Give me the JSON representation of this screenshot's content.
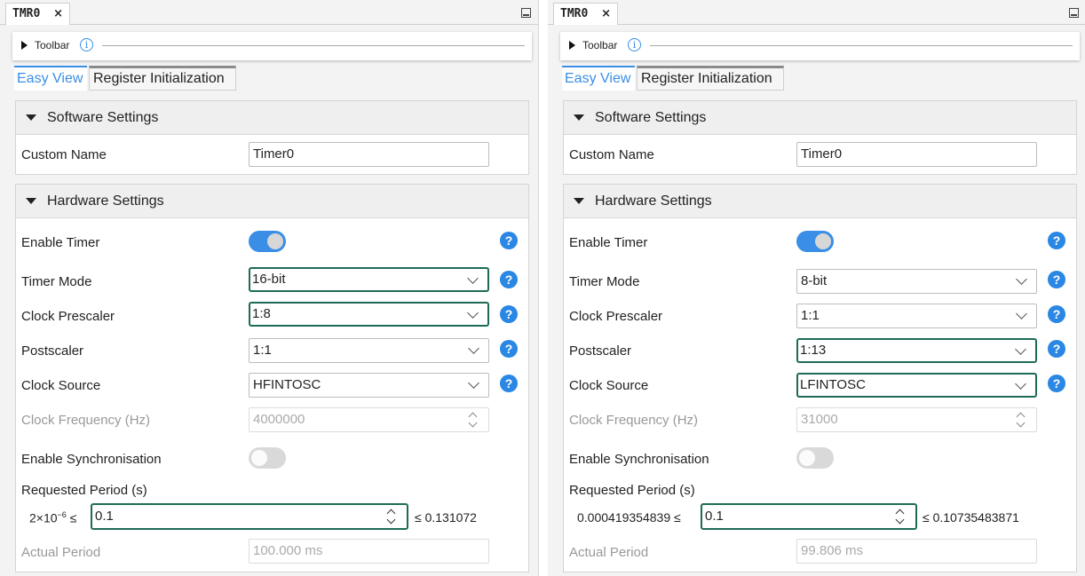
{
  "panels": [
    {
      "tab_title": "TMR0",
      "tab_close": "×",
      "toolbar_label": "Toolbar",
      "toolbar_info": "i",
      "view_tabs": {
        "easy": "Easy View",
        "register": "Register Initialization"
      },
      "software": {
        "title": "Software Settings",
        "custom_name_label": "Custom Name",
        "custom_name_value": "Timer0"
      },
      "hardware": {
        "title": "Hardware Settings",
        "enable_timer_label": "Enable Timer",
        "enable_timer_on": true,
        "timer_mode_label": "Timer Mode",
        "timer_mode_value": "16-bit",
        "prescaler_label": "Clock Prescaler",
        "prescaler_value": "1:8",
        "postscaler_label": "Postscaler",
        "postscaler_value": "1:1",
        "clock_source_label": "Clock Source",
        "clock_source_value": "HFINTOSC",
        "clock_freq_label": "Clock Frequency (Hz)",
        "clock_freq_value": "4000000",
        "sync_label": "Enable Synchronisation",
        "sync_on": false,
        "requested_period_label": "Requested Period (s)",
        "period_min_base": "2×10",
        "period_min_exp": "−6",
        "period_min_suffix": " ≤",
        "period_value": "0.1",
        "period_max": "≤ 0.131072",
        "actual_period_label": "Actual Period",
        "actual_period_value": "100.000 ms"
      }
    },
    {
      "tab_title": "TMR0",
      "tab_close": "×",
      "toolbar_label": "Toolbar",
      "toolbar_info": "i",
      "view_tabs": {
        "easy": "Easy View",
        "register": "Register Initialization"
      },
      "software": {
        "title": "Software Settings",
        "custom_name_label": "Custom Name",
        "custom_name_value": "Timer0"
      },
      "hardware": {
        "title": "Hardware Settings",
        "enable_timer_label": "Enable Timer",
        "enable_timer_on": true,
        "timer_mode_label": "Timer Mode",
        "timer_mode_value": "8-bit",
        "prescaler_label": "Clock Prescaler",
        "prescaler_value": "1:1",
        "postscaler_label": "Postscaler",
        "postscaler_value": "1:13",
        "clock_source_label": "Clock Source",
        "clock_source_value": "LFINTOSC",
        "clock_freq_label": "Clock Frequency (Hz)",
        "clock_freq_value": "31000",
        "sync_label": "Enable Synchronisation",
        "sync_on": false,
        "requested_period_label": "Requested Period (s)",
        "period_min": "0.000419354839 ≤",
        "period_value": "0.1",
        "period_max": "≤ 0.10735483871",
        "actual_period_label": "Actual Period",
        "actual_period_value": "99.806 ms"
      }
    }
  ],
  "help_icon": "?",
  "colors": {
    "accent": "#3a8ee6",
    "highlight": "#1d6b57",
    "help": "#2a87e4"
  }
}
